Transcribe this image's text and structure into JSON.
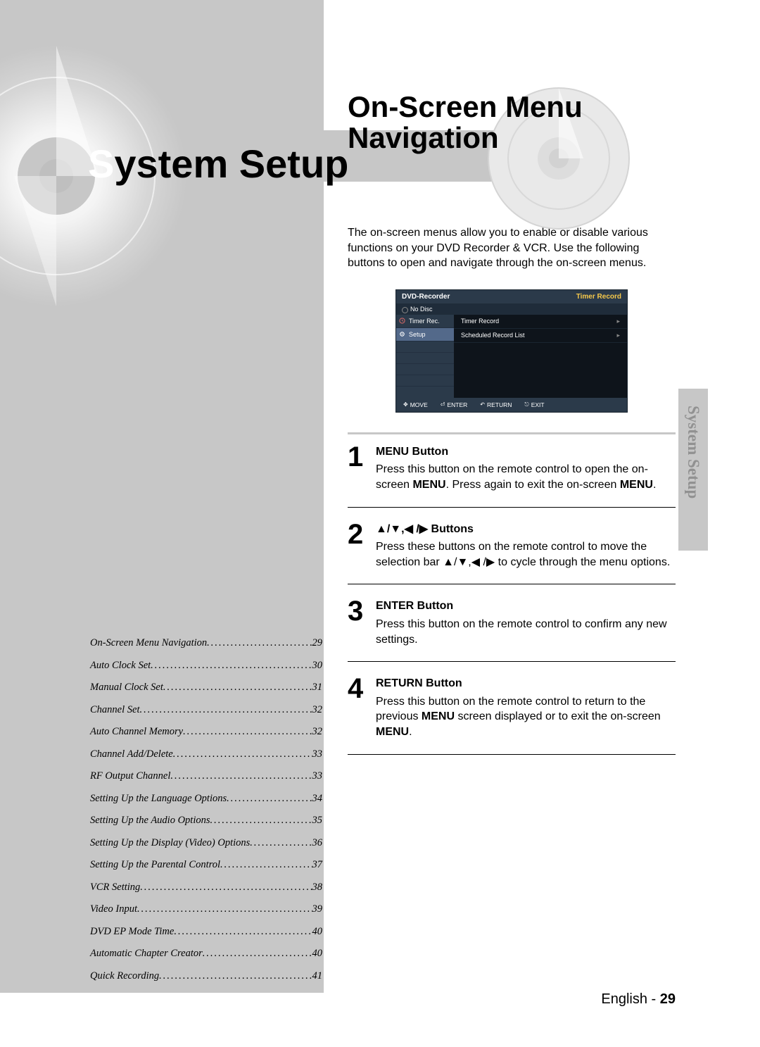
{
  "left": {
    "title_first": "S",
    "title_rest": "ystem Setup"
  },
  "toc": [
    {
      "label": "On-Screen Menu Navigation",
      "page": "29"
    },
    {
      "label": "Auto Clock Set ",
      "page": "30"
    },
    {
      "label": "Manual Clock Set ",
      "page": "31"
    },
    {
      "label": "Channel Set ",
      "page": "32"
    },
    {
      "label": "Auto Channel Memory",
      "page": "32"
    },
    {
      "label": "Channel Add/Delete ",
      "page": "33"
    },
    {
      "label": "RF Output Channel",
      "page": "33"
    },
    {
      "label": "Setting Up the Language Options ",
      "page": "34"
    },
    {
      "label": "Setting Up the Audio Options ",
      "page": "35"
    },
    {
      "label": "Setting Up the Display (Video) Options ",
      "page": "36"
    },
    {
      "label": "Setting Up the Parental Control ",
      "page": "37"
    },
    {
      "label": "VCR Setting ",
      "page": "38"
    },
    {
      "label": "Video Input ",
      "page": "39"
    },
    {
      "label": "DVD EP Mode Time ",
      "page": "40"
    },
    {
      "label": "Automatic Chapter Creator ",
      "page": "40"
    },
    {
      "label": "Quick Recording",
      "page": "41"
    }
  ],
  "right": {
    "title_line1": "On-Screen Menu",
    "title_line2": "Navigation",
    "intro": "The on-screen menus allow you to enable or disable various functions on your DVD Recorder & VCR. Use the following buttons to open and navigate through the on-screen menus."
  },
  "osd": {
    "top_left": "DVD-Recorder",
    "top_right": "Timer Record",
    "status": "No Disc",
    "side": [
      {
        "label": "Timer Rec."
      },
      {
        "label": "Setup"
      }
    ],
    "main": [
      {
        "label": "Timer Record"
      },
      {
        "label": "Scheduled Record List"
      }
    ],
    "foot": {
      "move": "MOVE",
      "enter": "ENTER",
      "return": "RETURN",
      "exit": "EXIT"
    }
  },
  "steps": [
    {
      "num": "1",
      "title": "MENU Button",
      "body_pre": "Press this button on the remote control to open the on-screen ",
      "body_bold1": "MENU",
      "body_mid": ". Press again to exit the on-screen ",
      "body_bold2": "MENU",
      "body_post": "."
    },
    {
      "num": "2",
      "title_arrows": "▲/▼,◀ /▶ Buttons",
      "body_pre": "Press these buttons on the remote control to move the selection bar ",
      "body_arrows": "▲/▼,◀ /▶",
      "body_post": " to cycle through the menu options."
    },
    {
      "num": "3",
      "title": "ENTER Button",
      "body": "Press this button on the remote control to confirm any new settings."
    },
    {
      "num": "4",
      "title": "RETURN Button",
      "body_pre": "Press this button on the remote control to return to the previous ",
      "body_bold1": "MENU",
      "body_mid": " screen displayed or to exit the on-screen ",
      "body_bold2": "MENU",
      "body_post": "."
    }
  ],
  "sidetab": "System Setup",
  "footer": {
    "lang": "English - ",
    "page": "29"
  }
}
